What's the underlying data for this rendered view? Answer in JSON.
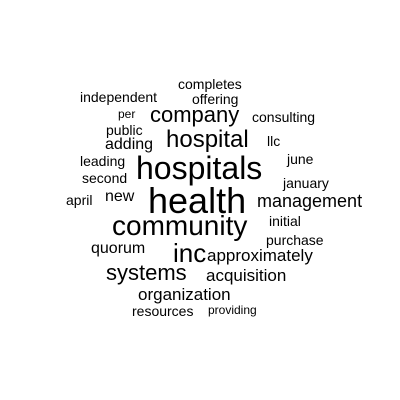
{
  "word_cloud": {
    "background_color": "#ffffff",
    "text_color": "#000000",
    "words": [
      {
        "text": "health",
        "size_rank": 1
      },
      {
        "text": "hospitals",
        "size_rank": 2
      },
      {
        "text": "community",
        "size_rank": 3
      },
      {
        "text": "hospital",
        "size_rank": 4
      },
      {
        "text": "inc",
        "size_rank": 5
      },
      {
        "text": "company",
        "size_rank": 6
      },
      {
        "text": "systems",
        "size_rank": 7
      },
      {
        "text": "management",
        "size_rank": 8
      },
      {
        "text": "approximately",
        "size_rank": 9
      },
      {
        "text": "acquisition",
        "size_rank": 10
      },
      {
        "text": "organization",
        "size_rank": 11
      },
      {
        "text": "quorum",
        "size_rank": 12
      },
      {
        "text": "adding",
        "size_rank": 13
      },
      {
        "text": "new",
        "size_rank": 14
      },
      {
        "text": "independent",
        "size_rank": 15
      },
      {
        "text": "consulting",
        "size_rank": 16
      },
      {
        "text": "completes",
        "size_rank": 17
      },
      {
        "text": "offering",
        "size_rank": 18
      },
      {
        "text": "public",
        "size_rank": 19
      },
      {
        "text": "leading",
        "size_rank": 20
      },
      {
        "text": "second",
        "size_rank": 21
      },
      {
        "text": "april",
        "size_rank": 22
      },
      {
        "text": "january",
        "size_rank": 23
      },
      {
        "text": "june",
        "size_rank": 24
      },
      {
        "text": "initial",
        "size_rank": 25
      },
      {
        "text": "purchase",
        "size_rank": 26
      },
      {
        "text": "resources",
        "size_rank": 27
      },
      {
        "text": "llc",
        "size_rank": 28
      },
      {
        "text": "per",
        "size_rank": 29
      },
      {
        "text": "providing",
        "size_rank": 30
      }
    ]
  }
}
